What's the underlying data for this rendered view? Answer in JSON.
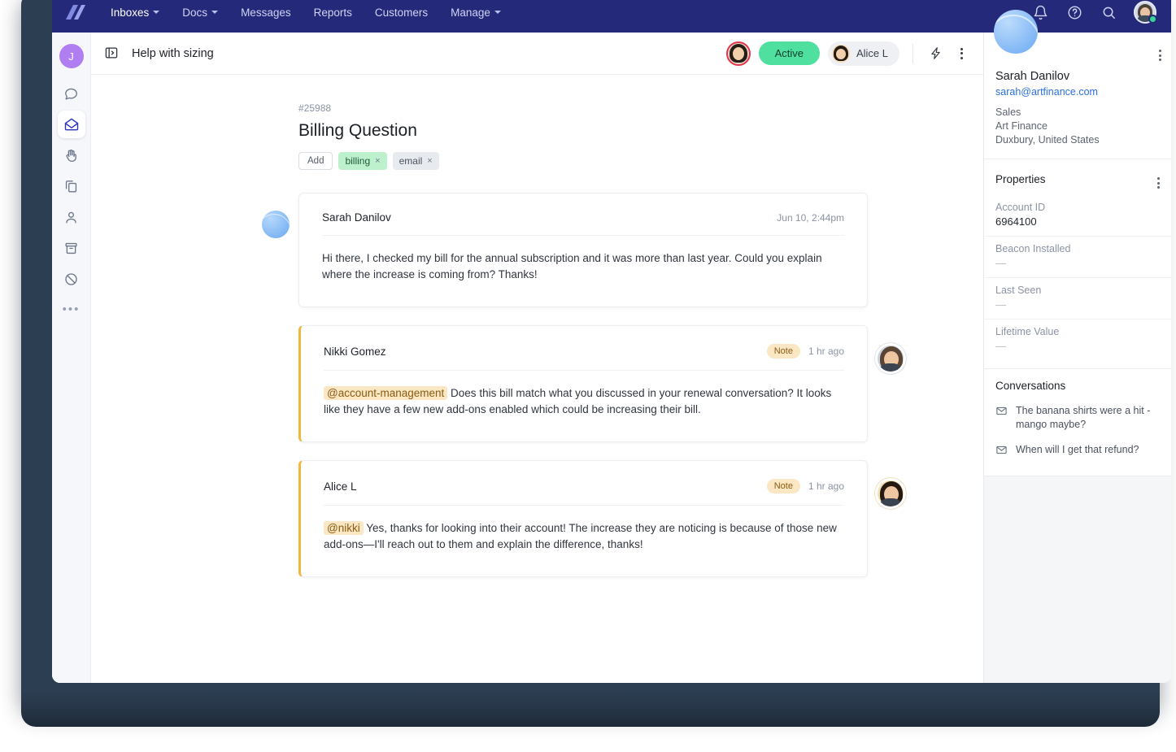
{
  "topnav": {
    "logo": "helpscout-logo-icon",
    "items": [
      {
        "label": "Inboxes",
        "caret": true
      },
      {
        "label": "Docs",
        "caret": true
      },
      {
        "label": "Messages",
        "caret": false
      },
      {
        "label": "Reports",
        "caret": false
      },
      {
        "label": "Customers",
        "caret": false
      },
      {
        "label": "Manage",
        "caret": true
      }
    ],
    "icons": [
      "bell-icon",
      "help-circle-icon",
      "search-icon"
    ],
    "avatar_status": "online",
    "bg_color": "#25297a"
  },
  "rail": {
    "avatar_initial": "J",
    "items": [
      {
        "name": "chat-bubble-icon",
        "active": false
      },
      {
        "name": "inbox-envelope-icon",
        "active": true
      },
      {
        "name": "hand-wave-icon",
        "active": false
      },
      {
        "name": "docs-icon",
        "active": false
      },
      {
        "name": "person-icon",
        "active": false
      },
      {
        "name": "archive-icon",
        "active": false
      },
      {
        "name": "blocked-icon",
        "active": false
      }
    ],
    "more": "•••"
  },
  "convo_header": {
    "panel_icon": "expand-panel-icon",
    "title": "Help with sizing",
    "status_label": "Active",
    "assignee": "Alice L",
    "workflow_icon": "lightning-bolt-icon",
    "more_icon": "kebab-menu-icon"
  },
  "ticket": {
    "number": "#25988",
    "title": "Billing Question",
    "add_tag_label": "Add",
    "tags": [
      {
        "label": "billing",
        "color": "green",
        "remove": "×"
      },
      {
        "label": "email",
        "color": "gray",
        "remove": "×"
      }
    ]
  },
  "messages": [
    {
      "author": "Sarah Danilov",
      "time": "Jun 10, 2:44pm",
      "badge": "",
      "kind": "customer",
      "mention": "",
      "body": "Hi there, I checked my bill for the annual subscription and it was more than last year. Could you explain where the increase is coming from? Thanks!"
    },
    {
      "author": "Nikki Gomez",
      "time": "1 hr ago",
      "badge": "Note",
      "kind": "note",
      "mention": "@account-management",
      "body": "Does this bill match what you discussed in your renewal conversation? It looks like they have a few new add-ons enabled which could be increasing their bill."
    },
    {
      "author": "Alice L",
      "time": "1 hr ago",
      "badge": "Note",
      "kind": "note",
      "mention": "@nikki",
      "body": "Yes, thanks for looking into their account! The increase they are noticing is because of those new add-ons—I'll reach out to them and explain the difference, thanks!"
    }
  ],
  "customer": {
    "name": "Sarah Danilov",
    "email": "sarah@artfinance.com",
    "role": "Sales",
    "company": "Art Finance",
    "location": "Duxbury, United States"
  },
  "properties": {
    "title": "Properties",
    "rows": [
      {
        "label": "Account ID",
        "value": "6964100",
        "empty": false
      },
      {
        "label": "Beacon Installed",
        "value": "—",
        "empty": true
      },
      {
        "label": "Last Seen",
        "value": "—",
        "empty": true
      },
      {
        "label": "Lifetime Value",
        "value": "—",
        "empty": true
      }
    ]
  },
  "conversations": {
    "title": "Conversations",
    "items": [
      {
        "icon": "envelope-icon",
        "text": "The banana shirts were a hit - mango maybe?"
      },
      {
        "icon": "envelope-icon",
        "text": "When will I get that refund?"
      }
    ]
  }
}
